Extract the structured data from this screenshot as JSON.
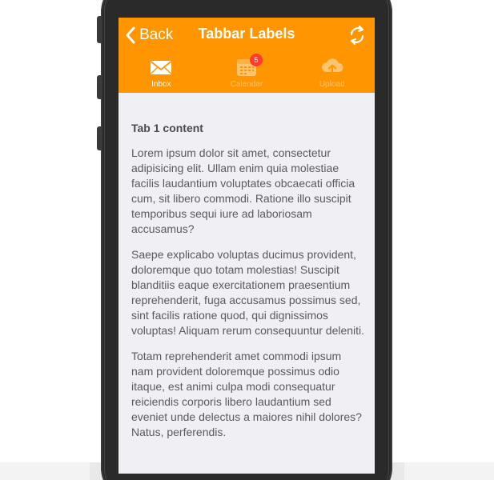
{
  "navbar": {
    "back_label": "Back",
    "title": "Tabbar Labels",
    "refresh_icon": "refresh-icon"
  },
  "tabs": [
    {
      "label": "Inbox",
      "icon": "envelope-icon",
      "active": true,
      "badge": null
    },
    {
      "label": "Calendar",
      "icon": "calendar-icon",
      "active": false,
      "badge": "5"
    },
    {
      "label": "Upload",
      "icon": "cloud-upload-icon",
      "active": false,
      "badge": null
    }
  ],
  "content": {
    "heading": "Tab 1 content",
    "paragraphs": [
      "Lorem ipsum dolor sit amet, consectetur adipisicing elit. Ullam enim quia molestiae facilis laudantium voluptates obcaecati officia cum, sit libero commodi. Ratione illo suscipit temporibus sequi iure ad laboriosam accusamus?",
      "Saepe explicabo voluptas ducimus provident, doloremque quo totam molestias! Suscipit blanditiis eaque exercitationem praesentium reprehenderit, fuga accusamus possimus sed, sint facilis ratione quod, qui dignissimos voluptas! Aliquam rerum consequuntur deleniti.",
      "Totam reprehenderit amet commodi ipsum nam provident doloremque possimus odio itaque, est animi culpa modi consequatur reiciendis corporis libero laudantium sed eveniet unde delectus a maiores nihil dolores? Natus, perferendis."
    ]
  },
  "colors": {
    "accent": "#ff9500",
    "badge": "#ff3b30",
    "background": "#efeff4",
    "text": "#5a5a5e"
  }
}
